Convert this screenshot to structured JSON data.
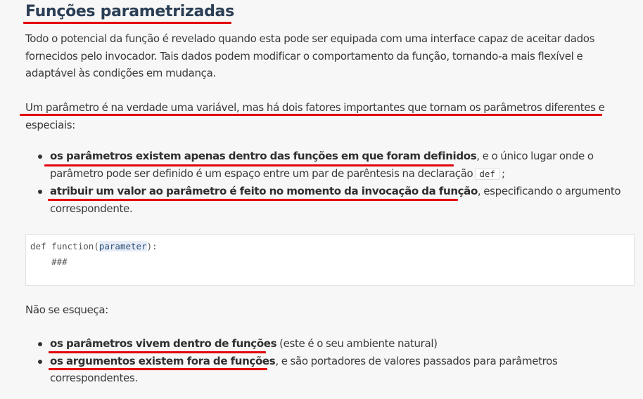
{
  "heading": "Funções parametrizadas",
  "intro_paragraph": "Todo o potencial da função é revelado quando esta pode ser equipada com uma interface capaz de aceitar dados fornecidos pelo invocador. Tais dados podem modificar o comportamento da função, tornando-a mais flexível e adaptável às condições em mudança.",
  "parameter_paragraph": "Um parâmetro é na verdade uma variável, mas há dois fatores importantes que tornam os parâmetros diferentes e especiais:",
  "facts": [
    {
      "bold": "os parâmetros existem apenas dentro das funções em que foram definidos",
      "rest": ", e o único lugar onde o parâmetro pode ser definido é um espaço entre um par de parêntesis na declaração",
      "code": "def",
      "tail": ";"
    },
    {
      "bold": "atribuir um valor ao parâmetro é feito no momento da invocação da função",
      "rest": ", especificando o argumento correspondente."
    }
  ],
  "code_block": {
    "keyword": "def",
    "function_name": "function",
    "open_paren": "(",
    "parameter": "parameter",
    "close": "):",
    "body": "###"
  },
  "reminder_label": "Não se esqueça:",
  "reminders": [
    {
      "bold": "os parâmetros vivem dentro de funções",
      "rest": " (este é o seu ambiente natural)"
    },
    {
      "bold": "os argumentos existem fora de funções",
      "rest": ", e são portadores de valores passados para parâmetros correspondentes."
    }
  ],
  "colors": {
    "underline": "#e3000b",
    "heading": "#2b3e55",
    "text": "#3a3a3a",
    "background": "#f7f7f7",
    "code_background": "#ffffff",
    "parameter_highlight": "#e7edf7"
  }
}
